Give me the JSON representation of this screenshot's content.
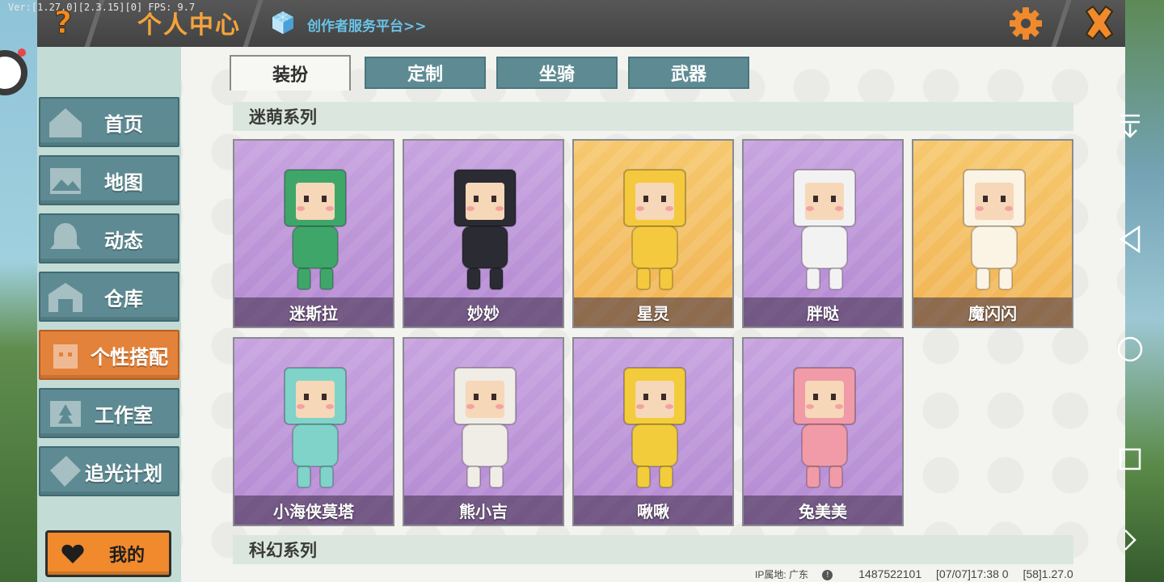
{
  "version_overlay": "Ver:[1.27.0][2.3.15][0] FPS: 9.7",
  "header": {
    "help_label": "?",
    "title": "个人中心",
    "creator_link": "创作者服务平台>>"
  },
  "sidebar": {
    "items": [
      {
        "label": "首页",
        "icon": "house-icon"
      },
      {
        "label": "地图",
        "icon": "map-icon"
      },
      {
        "label": "动态",
        "icon": "bell-icon"
      },
      {
        "label": "仓库",
        "icon": "warehouse-icon"
      },
      {
        "label": "个性搭配",
        "icon": "avatar-icon",
        "active": true
      },
      {
        "label": "工作室",
        "icon": "studio-icon"
      },
      {
        "label": "追光计划",
        "icon": "plan-icon"
      }
    ],
    "mine_button": "我的"
  },
  "tabs": [
    {
      "label": "装扮",
      "active": true
    },
    {
      "label": "定制"
    },
    {
      "label": "坐骑"
    },
    {
      "label": "武器"
    }
  ],
  "sections": [
    {
      "title": "迷萌系列",
      "items": [
        {
          "name": "迷斯拉",
          "bg": "purple",
          "color": "#3fa66a"
        },
        {
          "name": "妙妙",
          "bg": "purple",
          "color": "#2b2b34"
        },
        {
          "name": "星灵",
          "bg": "orange",
          "color": "#f4c93e"
        },
        {
          "name": "胖哒",
          "bg": "purple",
          "color": "#f2f2f2"
        },
        {
          "name": "魔闪闪",
          "bg": "orange",
          "color": "#fbf3e4"
        },
        {
          "name": "小海侠莫塔",
          "bg": "purple",
          "color": "#7fd3c9"
        },
        {
          "name": "熊小吉",
          "bg": "purple",
          "color": "#f0ece6"
        },
        {
          "name": "啾啾",
          "bg": "purple",
          "color": "#f2cc3a"
        },
        {
          "name": "兔美美",
          "bg": "purple",
          "color": "#f19aa8"
        }
      ]
    },
    {
      "title": "科幻系列",
      "items": []
    }
  ],
  "footer": {
    "ip_label": "IP属地: 广东",
    "uid": "1487522101",
    "timestamp": "[07/07]17:38 0",
    "build": "[58]1.27.0"
  },
  "colors": {
    "accent_orange": "#f08a2c",
    "tab_teal": "#5e8b93",
    "title_orange": "#f5a33a",
    "link_blue": "#69c3e8"
  }
}
